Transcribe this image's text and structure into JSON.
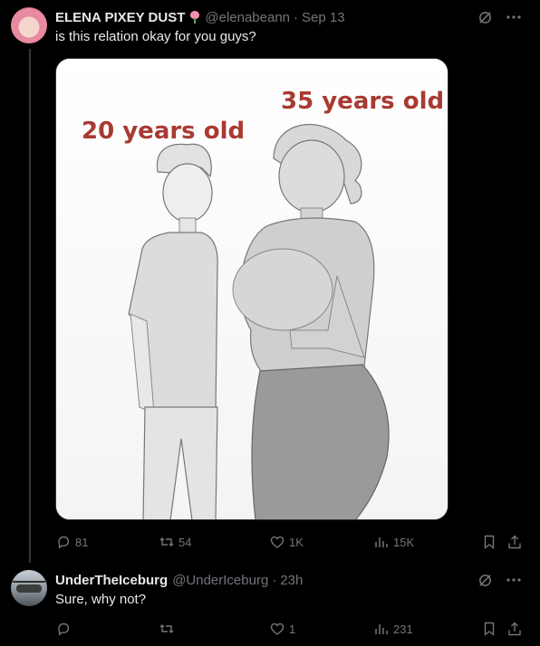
{
  "main_post": {
    "display_name": "ELENA PIXEY DUST",
    "name_emoji": "tulip",
    "handle": "@elenabeann",
    "separator": "·",
    "date": "Sep 13",
    "text": "is this relation okay for you guys?",
    "image": {
      "label_left": "20 years old",
      "label_right": "35 years old",
      "label_color": "#a83a32"
    },
    "stats": {
      "replies": "81",
      "reposts": "54",
      "likes": "1K",
      "views": "15K"
    }
  },
  "reply": {
    "display_name": "UnderTheIceburg",
    "handle": "@UnderIceburg",
    "separator": "·",
    "time": "23h",
    "text": "Sure, why not?",
    "stats": {
      "replies": "",
      "reposts": "",
      "likes": "1",
      "views": "231"
    }
  },
  "icons": {
    "grok": "grok-icon",
    "more": "more-horizontal-icon",
    "reply": "reply-icon",
    "repost": "repost-icon",
    "like": "heart-icon",
    "views": "views-chart-icon",
    "bookmark": "bookmark-icon",
    "share": "share-icon"
  },
  "colors": {
    "background": "#000000",
    "text_primary": "#e7e9ea",
    "text_secondary": "#71767b",
    "border": "#2f3336"
  }
}
